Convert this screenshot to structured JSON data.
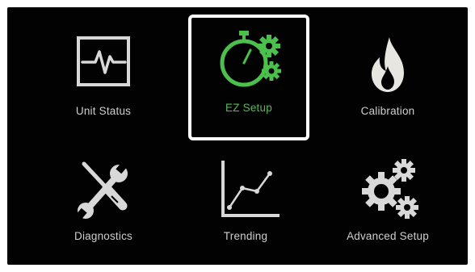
{
  "menu": {
    "selected": "EZ Setup",
    "accent_color": "#4cc04d",
    "items": [
      {
        "label": "Unit Status",
        "icon": "waveform-monitor-icon"
      },
      {
        "label": "EZ Setup",
        "icon": "stopwatch-gears-icon"
      },
      {
        "label": "Calibration",
        "icon": "flame-icon"
      },
      {
        "label": "Diagnostics",
        "icon": "wrench-screwdriver-icon"
      },
      {
        "label": "Trending",
        "icon": "line-graph-icon"
      },
      {
        "label": "Advanced Setup",
        "icon": "gears-icon"
      }
    ]
  }
}
